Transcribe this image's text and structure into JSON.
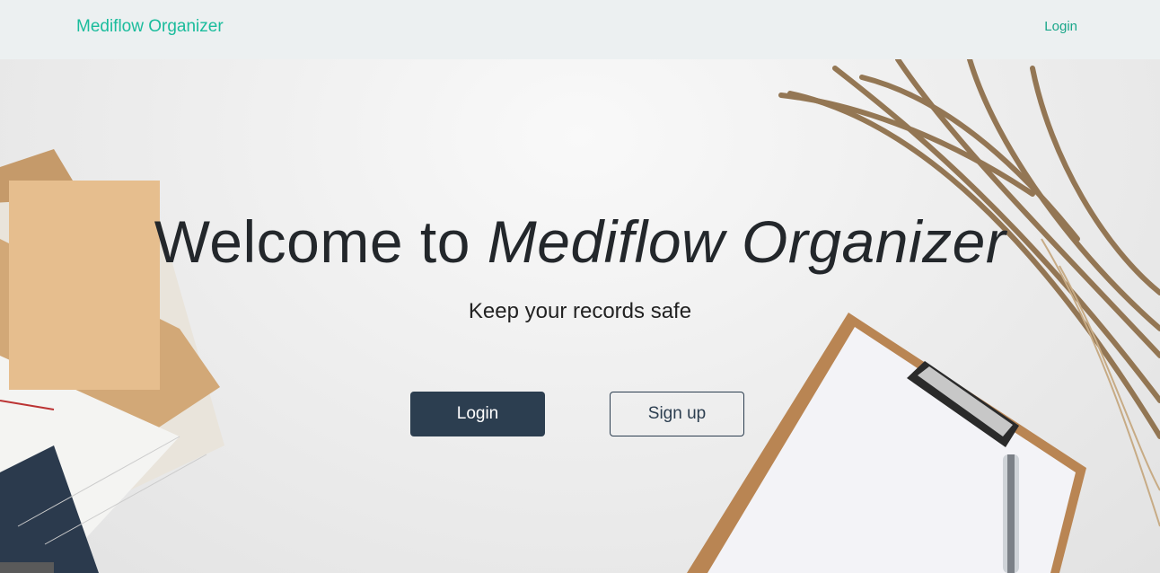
{
  "navbar": {
    "brand": "Mediflow Organizer",
    "login_link": "Login"
  },
  "hero": {
    "heading_prefix": "Welcome to ",
    "heading_brand": "Mediflow Organizer",
    "tagline": "Keep your records safe",
    "login_button": "Login",
    "signup_button": "Sign up"
  },
  "colors": {
    "brand": "#1abc9c",
    "primary_button": "#2c3e50",
    "navbar_bg": "#ecf0f1"
  }
}
